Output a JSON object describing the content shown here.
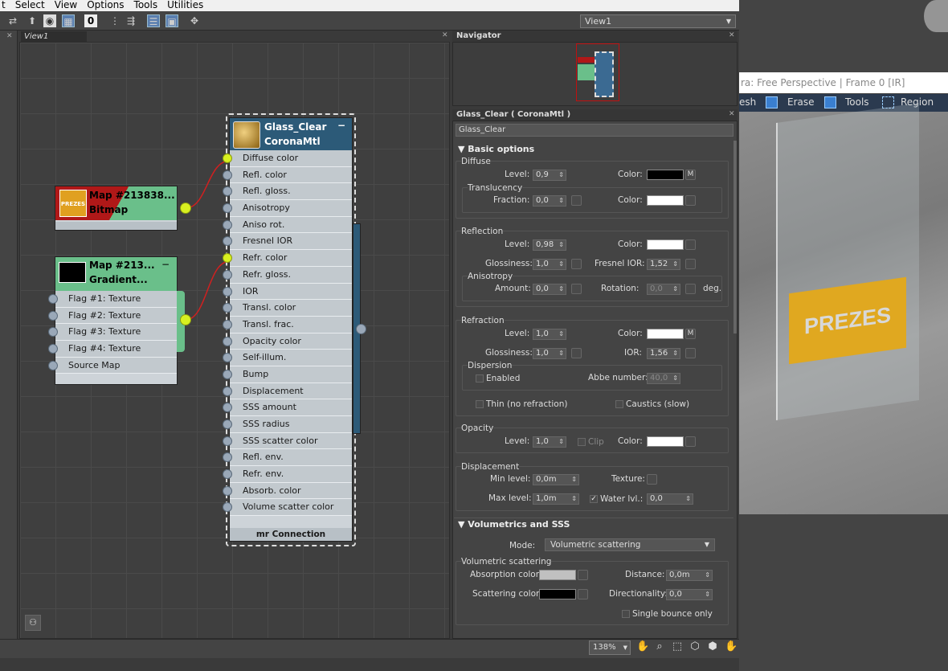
{
  "menu": [
    "t",
    "Select",
    "View",
    "Options",
    "Tools",
    "Utilities"
  ],
  "toolbar": {
    "view_dropdown": "View1",
    "sel_count": "0"
  },
  "view_tab": "View1",
  "navigator": {
    "title": "Navigator"
  },
  "nodes": {
    "main": {
      "title_line1": "Glass_Clear",
      "title_line2": "CoronaMtl",
      "slots": [
        "Diffuse color",
        "Refl. color",
        "Refl. gloss.",
        "Anisotropy",
        "Aniso rot.",
        "Fresnel IOR",
        "Refr. color",
        "Refr. gloss.",
        "IOR",
        "Transl. color",
        "Transl. frac.",
        "Opacity color",
        "Self-illum.",
        "Bump",
        "Displacement",
        "SSS amount",
        "SSS radius",
        "SSS scatter color",
        "Refl. env.",
        "Refr. env.",
        "Absorb. color",
        "Volume scatter color"
      ],
      "connected": [
        0,
        6
      ],
      "footer": "mr Connection"
    },
    "bitmap": {
      "title_line1": "Map #213838...",
      "title_line2": "Bitmap",
      "thumb_text": "PREZES"
    },
    "gradient": {
      "title_line1": "Map #213...",
      "title_line2": "Gradient...",
      "slots": [
        "Flag #1: Texture",
        "Flag #2: Texture",
        "Flag #3: Texture",
        "Flag #4: Texture",
        "Source Map"
      ]
    }
  },
  "material_panel": {
    "header": "Glass_Clear  ( CoronaMtl )",
    "name": "Glass_Clear",
    "basic_options": "Basic options",
    "diffuse": {
      "group": "Diffuse",
      "level_label": "Level:",
      "level": "0,9",
      "color_label": "Color:",
      "m": "M",
      "translucency": "Translucency",
      "fraction_label": "Fraction:",
      "fraction": "0,0",
      "color2_label": "Color:"
    },
    "reflection": {
      "group": "Reflection",
      "level_label": "Level:",
      "level": "0,98",
      "color_label": "Color:",
      "gloss_label": "Glossiness:",
      "gloss": "1,0",
      "fresnel_label": "Fresnel IOR:",
      "fresnel": "1,52",
      "anisotropy": "Anisotropy",
      "amount_label": "Amount:",
      "amount": "0,0",
      "rotation_label": "Rotation:",
      "rotation": "0,0",
      "deg": "deg."
    },
    "refraction": {
      "group": "Refraction",
      "level_label": "Level:",
      "level": "1,0",
      "color_label": "Color:",
      "m": "M",
      "gloss_label": "Glossiness:",
      "gloss": "1,0",
      "ior_label": "IOR:",
      "ior": "1,56",
      "dispersion": "Dispersion",
      "enabled": "Enabled",
      "abbe_label": "Abbe number:",
      "abbe": "40,0",
      "thin": "Thin (no refraction)",
      "caustics": "Caustics (slow)"
    },
    "opacity": {
      "group": "Opacity",
      "level_label": "Level:",
      "level": "1,0",
      "clip": "Clip",
      "color_label": "Color:"
    },
    "displacement": {
      "group": "Displacement",
      "min_label": "Min level:",
      "min": "0,0m",
      "texture_label": "Texture:",
      "max_label": "Max level:",
      "max": "1,0m",
      "water_label": "Water lvl.:",
      "water": "0,0"
    },
    "volumetrics": "Volumetrics and SSS",
    "mode_label": "Mode:",
    "mode": "Volumetric scattering",
    "volumetric": {
      "group": "Volumetric scattering",
      "absorption_label": "Absorption color:",
      "distance_label": "Distance:",
      "distance": "0,0m",
      "scattering_label": "Scattering color:",
      "directionality_label": "Directionality:",
      "directionality": "0,0",
      "single_bounce": "Single bounce only"
    }
  },
  "status": {
    "zoom": "138%"
  },
  "vfb": {
    "title": "ra: Free Perspective | Frame 0 [IR]",
    "tools": [
      "esh",
      "Erase",
      "Tools",
      "Region"
    ],
    "sign_text": "PREZES"
  },
  "colors": {
    "node_header": "#2c5a78",
    "bitmap_red": "#b01818",
    "node_green": "#6abf8a",
    "socket_active": "#d8f020",
    "wire": "#d02020"
  }
}
